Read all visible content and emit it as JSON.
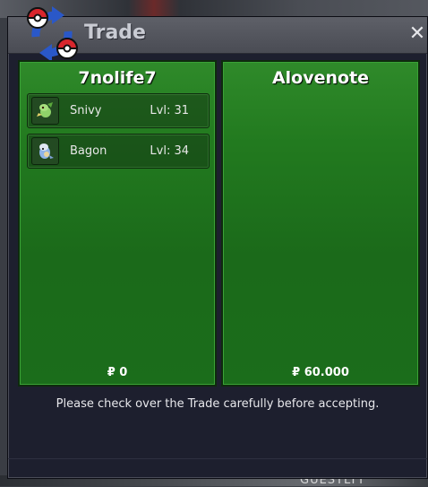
{
  "window": {
    "title": "Trade",
    "close_icon": "close-icon"
  },
  "left_panel": {
    "player": "7nolife7",
    "pokemon": [
      {
        "name": "Snivy",
        "level": "Lvl: 31",
        "icon": "snivy-icon"
      },
      {
        "name": "Bagon",
        "level": "Lvl: 34",
        "icon": "bagon-icon"
      }
    ],
    "money": "₽ 0"
  },
  "right_panel": {
    "player": "Alovenote",
    "pokemon": [],
    "money": "₽ 60.000"
  },
  "message": "Please check over the Trade carefully before accepting.",
  "background": {
    "bottom_text": "GUESTLTT"
  },
  "colors": {
    "panel_green": "#227a1f",
    "window_bg": "#1d1f2e",
    "titlebar": "#55575f"
  }
}
